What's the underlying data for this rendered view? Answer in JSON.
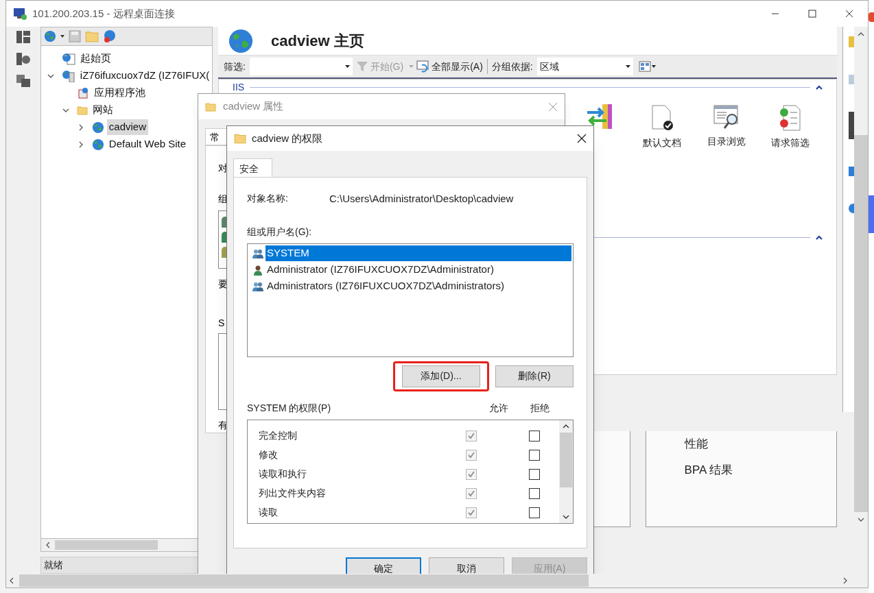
{
  "window": {
    "title": "101.200.203.15 - 远程桌面连接"
  },
  "tree": [
    {
      "label": "起始页",
      "kind": "start",
      "selected": false
    },
    {
      "label": "iZ76ifuxcuox7dZ (IZ76IFUX(",
      "kind": "server",
      "selected": false,
      "expanded": true,
      "children": [
        {
          "label": "应用程序池",
          "kind": "pool",
          "selected": false
        },
        {
          "label": "网站",
          "kind": "sites",
          "selected": false,
          "expanded": true,
          "children": [
            {
              "label": "cadview",
              "kind": "site",
              "selected": true,
              "expanded": false
            },
            {
              "label": "Default Web Site",
              "kind": "site",
              "selected": false,
              "expanded": false
            }
          ]
        }
      ]
    }
  ],
  "status_bar": "就绪",
  "home": {
    "title": "cadview 主页",
    "filter_label": "筛选:",
    "start": "开始(G)",
    "show_all": "全部显示(A)",
    "group_by_label": "分组依据:",
    "group_by_value": "区域",
    "group_label": "IIS",
    "features": [
      {
        "label": "默认文档",
        "kind": "document"
      },
      {
        "label": "目录浏览",
        "kind": "browse"
      },
      {
        "label": "请求筛选",
        "kind": "filter"
      }
    ]
  },
  "lower_pane": [
    "性能",
    "BPA 结果"
  ],
  "properties_dialog": {
    "title": "cadview 属性",
    "tab": "常",
    "fragments": [
      "对",
      "组",
      "要",
      "S",
      "有"
    ]
  },
  "permissions_dialog": {
    "title": "cadview 的权限",
    "tabs": [
      {
        "label": "安全",
        "selected": true
      }
    ],
    "object_label": "对象名称:",
    "object_value": "C:\\Users\\Administrator\\Desktop\\cadview",
    "users_label": "组或用户名(G):",
    "users": [
      {
        "name": "SYSTEM",
        "kind": "group",
        "selected": true
      },
      {
        "name": "Administrator (IZ76IFUXCUOX7DZ\\Administrator)",
        "kind": "user",
        "selected": false
      },
      {
        "name": "Administrators (IZ76IFUXCUOX7DZ\\Administrators)",
        "kind": "group",
        "selected": false
      }
    ],
    "buttons": [
      {
        "label": "添加(D)...",
        "highlighted": true
      },
      {
        "label": "删除(R)",
        "highlighted": false
      }
    ],
    "permissions_label": "SYSTEM 的权限(P)",
    "allow_header": "允许",
    "deny_header": "拒绝",
    "permissions": [
      {
        "name": "完全控制",
        "allow": true,
        "deny": false,
        "inherited": true
      },
      {
        "name": "修改",
        "allow": true,
        "deny": false,
        "inherited": true
      },
      {
        "name": "读取和执行",
        "allow": true,
        "deny": false,
        "inherited": true
      },
      {
        "name": "列出文件夹内容",
        "allow": true,
        "deny": false,
        "inherited": true
      },
      {
        "name": "读取",
        "allow": true,
        "deny": false,
        "inherited": true
      }
    ],
    "footer_buttons": [
      {
        "label": "确定",
        "kind": "default"
      },
      {
        "label": "取消",
        "kind": "normal"
      },
      {
        "label": "应用(A)",
        "kind": "disabled"
      }
    ]
  }
}
